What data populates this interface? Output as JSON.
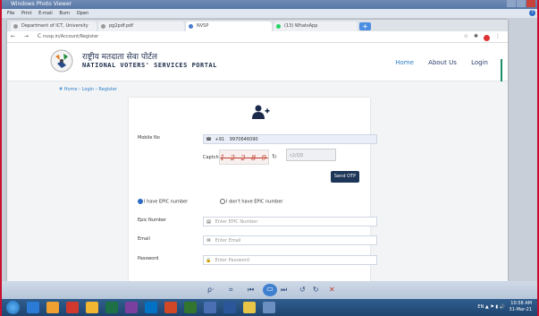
{
  "viewer": {
    "title": "Windows Photo Viewer",
    "menu": [
      "File",
      "Print",
      "E-mail",
      "Burn",
      "Open"
    ],
    "help": "?"
  },
  "browser": {
    "tabs": [
      {
        "label": "Department of ICT, University",
        "active": false
      },
      {
        "label": "pg2pdf.pdf",
        "active": false
      },
      {
        "label": "NVSP",
        "active": true
      },
      {
        "label": "(13) WhatsApp",
        "active": false
      }
    ],
    "newtab": "+",
    "url": "nvsp.in/Account/Register",
    "nav": "←  →  C"
  },
  "site": {
    "brand_hindi": "राष्ट्रीय मतदाता सेवा पोर्टल",
    "brand_english": "NATIONAL VOTERS' SERVICES PORTAL",
    "nav": {
      "home": "Home",
      "about": "About Us",
      "login": "Login"
    },
    "breadcrumb": "# Home › Login › Register"
  },
  "form": {
    "mobile_label": "Mobile No",
    "country_code": "+91",
    "mobile_value": "9970646090",
    "captcha_label": "Captcha",
    "captcha_text": "1 2 2 8 9",
    "captcha_placeholder": "c2/QD",
    "send_otp": "Send OTP",
    "radio_epic": "I have EPIC number",
    "radio_no_epic": "I don't have EPIC number",
    "epic_label": "Epic Number",
    "epic_placeholder": "Enter EPIC Number",
    "email_label": "Email",
    "email_placeholder": "Enter Email",
    "password_label": "Password",
    "password_placeholder": "Enter Password"
  },
  "tray": {
    "lang": "EN",
    "time": "10:58 AM",
    "date": "31-Mar-21"
  }
}
